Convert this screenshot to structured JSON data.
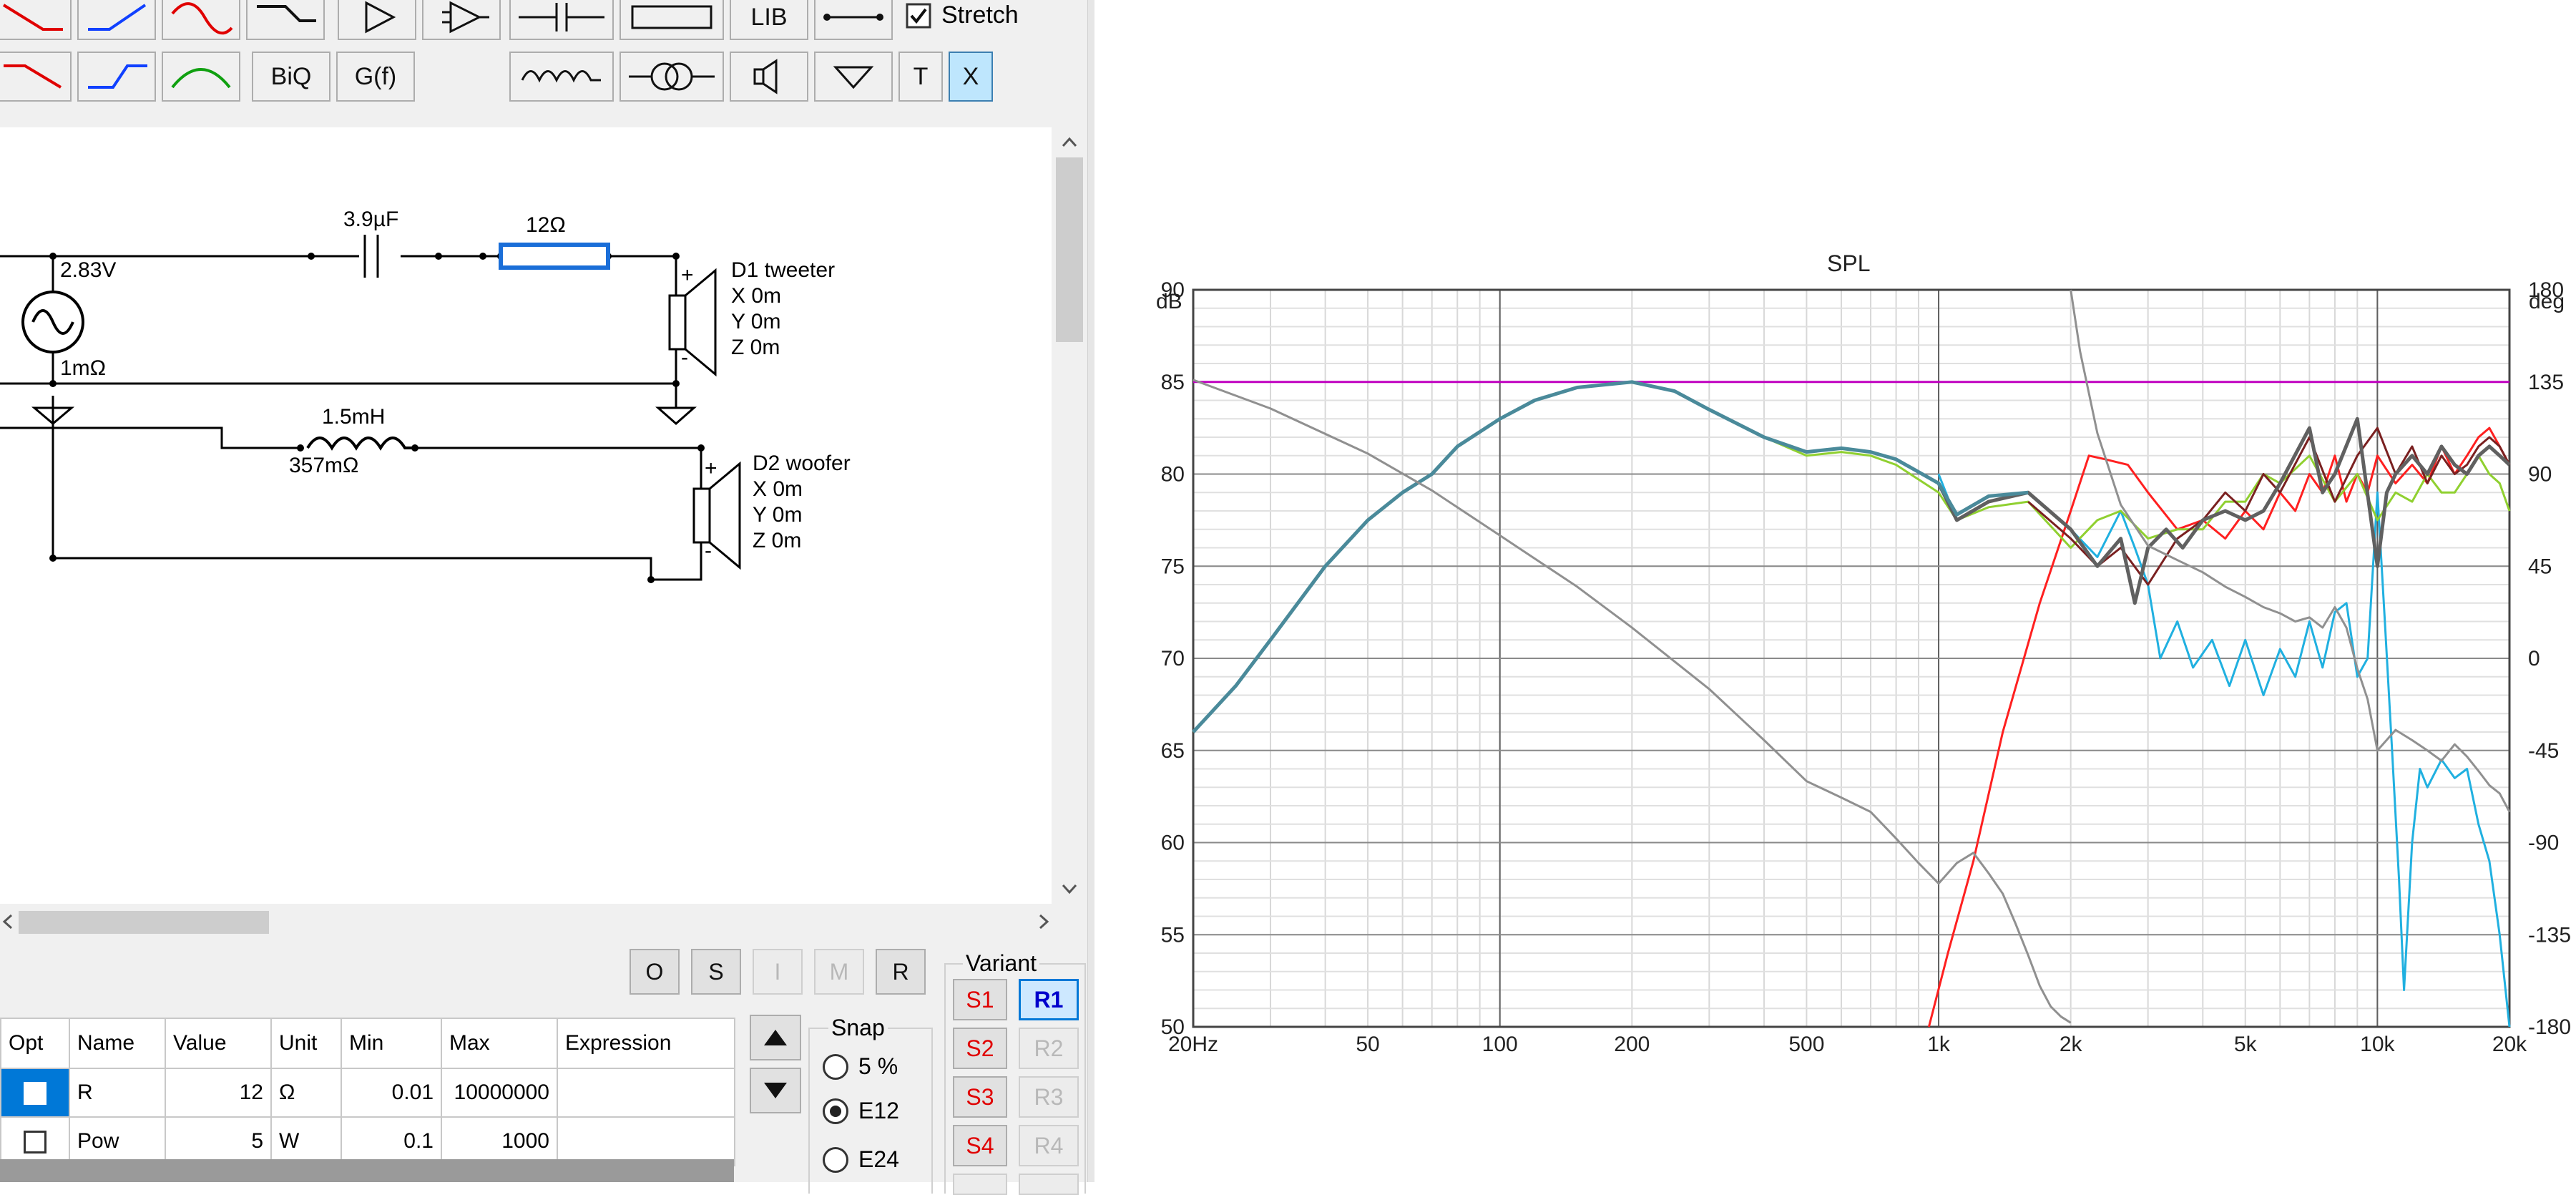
{
  "toolbar": {
    "lib_label": "LIB",
    "stretch_label": "Stretch",
    "stretch_checked": true,
    "biq_label": "BiQ",
    "gf_label": "G(f)",
    "t_label": "T",
    "x_label": "X"
  },
  "schematic": {
    "source_voltage": "2.83V",
    "source_resistance": "1mΩ",
    "capacitor_value": "3.9µF",
    "resistor_value": "12Ω",
    "inductor_value": "1.5mH",
    "inductor_resistance": "357mΩ",
    "driver1": {
      "name": "D1 tweeter",
      "x": "X 0m",
      "y": "Y 0m",
      "z": "Z 0m"
    },
    "driver2": {
      "name": "D2 woofer",
      "x": "X 0m",
      "y": "Y 0m",
      "z": "Z 0m"
    },
    "plus": "+",
    "minus": "-"
  },
  "opt_buttons": [
    "O",
    "S",
    "I",
    "M",
    "R"
  ],
  "table": {
    "headers": [
      "Opt",
      "Name",
      "Value",
      "Unit",
      "Min",
      "Max",
      "Expression"
    ],
    "rows": [
      {
        "name": "R",
        "value": "12",
        "unit": "Ω",
        "min": "0.01",
        "max": "10000000",
        "expression": ""
      },
      {
        "name": "Pow",
        "value": "5",
        "unit": "W",
        "min": "0.1",
        "max": "1000",
        "expression": ""
      }
    ]
  },
  "snap": {
    "label": "Snap",
    "options": [
      "5 %",
      "E12",
      "E24"
    ],
    "selected": "E12"
  },
  "variant": {
    "label": "Variant",
    "s_buttons": [
      "S1",
      "S2",
      "S3",
      "S4"
    ],
    "r_buttons": [
      "R1",
      "R2",
      "R3",
      "R4"
    ],
    "selected_r": "R1"
  },
  "chart_data": {
    "type": "line",
    "title": "SPL",
    "ylabel": "dB",
    "y2label": "deg",
    "xscale": "log",
    "xlim": [
      20,
      20000
    ],
    "ylim": [
      50,
      90
    ],
    "y2lim": [
      -180,
      180
    ],
    "xticks": [
      20,
      50,
      100,
      200,
      500,
      1000,
      2000,
      5000,
      10000,
      20000
    ],
    "xticklabels": [
      "20Hz",
      "50",
      "100",
      "200",
      "500",
      "1k",
      "2k",
      "5k",
      "10k",
      "20k"
    ],
    "yticks": [
      50,
      55,
      60,
      65,
      70,
      75,
      80,
      85,
      90
    ],
    "yticklabels": [
      "50",
      "55",
      "60",
      "65",
      "70",
      "75",
      "80",
      "85",
      "90"
    ],
    "y2ticks": [
      -180,
      -135,
      -90,
      -45,
      0,
      45,
      90,
      135,
      180
    ],
    "y2ticklabels": [
      "-180",
      "-135",
      "-90",
      "-45",
      "0",
      "45",
      "90",
      "135",
      "180"
    ],
    "grid": true,
    "series": [
      {
        "color": "#c000c0",
        "axis": "left",
        "x": [
          20,
          20000
        ],
        "y": [
          85,
          85
        ]
      },
      {
        "color": "#ff2020",
        "axis": "left",
        "x": [
          950,
          1050,
          1200,
          1400,
          1700,
          2000,
          2200,
          2400,
          2700,
          3000,
          3500,
          4000,
          4500,
          5000,
          5500,
          6000,
          6500,
          7000,
          7500,
          8000,
          8500,
          9000,
          9500,
          10000,
          11000,
          12000,
          13000,
          14000,
          15000,
          16000,
          17000,
          18000,
          19000,
          20000
        ],
        "y": [
          50,
          54,
          59,
          66,
          73,
          78,
          81,
          80.8,
          80.5,
          79,
          77,
          77.5,
          76.5,
          78,
          77,
          79,
          78,
          80,
          79,
          81,
          78.5,
          80,
          79,
          81,
          79.5,
          80.5,
          79.5,
          81.5,
          80,
          81,
          82,
          82.5,
          81.5,
          80.5
        ]
      },
      {
        "color": "#20b0e0",
        "axis": "left",
        "x": [
          1000,
          1100,
          1300,
          1600,
          2000,
          2300,
          2600,
          2800,
          3000,
          3200,
          3500,
          3800,
          4200,
          4600,
          5000,
          5500,
          6000,
          6500,
          7000,
          7500,
          8000,
          8500,
          9000,
          9500,
          10000,
          10400,
          10800,
          11200,
          11500,
          12000,
          12500,
          13000,
          14000,
          15000,
          16000,
          17000,
          18000,
          19000,
          20000
        ],
        "y": [
          80,
          77.5,
          78.5,
          79,
          77,
          75.5,
          78,
          76,
          74,
          70,
          72,
          69.5,
          71,
          68.5,
          71,
          68,
          70.5,
          69,
          72,
          69.5,
          72.5,
          73,
          69,
          70,
          79,
          72,
          65,
          58,
          52,
          60,
          64,
          63,
          64.5,
          63.5,
          64,
          61,
          59,
          55,
          50
        ]
      },
      {
        "color": "#90d030",
        "axis": "left",
        "x": [
          20,
          25,
          30,
          40,
          50,
          60,
          70,
          80,
          100,
          120,
          150,
          200,
          250,
          300,
          400,
          500,
          600,
          700,
          800,
          1000,
          1100,
          1300,
          1600,
          2000,
          2300,
          2600,
          3000,
          3500,
          4000,
          4500,
          5000,
          5500,
          6000,
          7000,
          8000,
          9000,
          10000,
          11000,
          12000,
          13000,
          14000,
          15000,
          16000,
          17000,
          18000,
          19000,
          20000
        ],
        "y": [
          66,
          68.5,
          71,
          75,
          77.5,
          79,
          80,
          81.5,
          83,
          84,
          84.7,
          85,
          84.5,
          83.5,
          82,
          81,
          81.2,
          81,
          80.5,
          79,
          77.5,
          78.2,
          78.5,
          76,
          77.5,
          78,
          76.5,
          77,
          77,
          78.5,
          78.5,
          80,
          79.5,
          81,
          78.5,
          80,
          77.5,
          79,
          78.5,
          80,
          79,
          79,
          80,
          81,
          80,
          79.5,
          78
        ]
      },
      {
        "color": "#7a2020",
        "axis": "left",
        "x": [
          1600,
          2000,
          2300,
          2600,
          3000,
          3500,
          4000,
          4500,
          5000,
          5500,
          6000,
          7000,
          8000,
          9000,
          10000,
          11000,
          12000,
          13000,
          14000,
          15000,
          16000,
          17000,
          18000,
          19000,
          20000
        ],
        "y": [
          78.5,
          76.5,
          75,
          76,
          74,
          76.5,
          77.5,
          79,
          78,
          80,
          79,
          82,
          78.5,
          81,
          82.5,
          80,
          81.5,
          79.5,
          81,
          80,
          80.5,
          81.5,
          82,
          81.5,
          80.5
        ]
      },
      {
        "color": "#606060",
        "axis": "left",
        "width": 5,
        "x": [
          1000,
          1100,
          1300,
          1600,
          2000,
          2300,
          2600,
          2800,
          3000,
          3300,
          3600,
          4000,
          4500,
          5000,
          5500,
          6000,
          7000,
          7500,
          8000,
          9000,
          10000,
          10500,
          11000,
          12000,
          13000,
          14000,
          15000,
          16000,
          17000,
          18000,
          19000,
          20000
        ],
        "y": [
          79.5,
          77.5,
          78.5,
          79,
          77,
          75,
          76.5,
          73,
          76,
          77,
          76,
          77.5,
          78,
          77.5,
          78,
          79.5,
          82.5,
          79,
          80,
          83,
          75,
          79,
          80,
          81,
          80,
          81.5,
          80.5,
          80,
          81,
          81.5,
          81,
          80.5
        ]
      },
      {
        "color": "#4a8a9a",
        "axis": "left",
        "width": 5,
        "x": [
          20,
          25,
          30,
          40,
          50,
          60,
          70,
          80,
          100,
          120,
          150,
          200,
          250,
          300,
          400,
          500,
          600,
          700,
          800,
          1000,
          1100,
          1300,
          1600
        ],
        "y": [
          66,
          68.5,
          71,
          75,
          77.5,
          79,
          80,
          81.5,
          83,
          84,
          84.7,
          85,
          84.5,
          83.5,
          82,
          81.2,
          81.4,
          81.2,
          80.8,
          79.5,
          77.8,
          78.8,
          79
        ]
      },
      {
        "color": "#909090",
        "axis": "right",
        "x": [
          20,
          30,
          50,
          70,
          100,
          150,
          200,
          300,
          400,
          500,
          600,
          700,
          800,
          900,
          1000,
          1100,
          1200,
          1300,
          1400,
          1500,
          1600,
          1700,
          1800,
          1900,
          2000
        ],
        "y": [
          136,
          122,
          100,
          82,
          60,
          35,
          15,
          -15,
          -40,
          -60,
          -68,
          -75,
          -88,
          -100,
          -110,
          -100,
          -95,
          -105,
          -115,
          -130,
          -145,
          -160,
          -170,
          -175,
          -178
        ]
      },
      {
        "color": "#909090",
        "axis": "right",
        "x": [
          2000,
          2100,
          2300,
          2600,
          3000,
          3500,
          4000,
          4500,
          5000,
          5500,
          6000,
          6500,
          7000,
          7500,
          8000,
          8500,
          9000,
          9500,
          10000,
          11000,
          12000,
          13000,
          14000,
          15000,
          16000,
          17000,
          18000,
          19000,
          20000
        ],
        "y": [
          180,
          150,
          110,
          75,
          55,
          48,
          42,
          35,
          30,
          25,
          22,
          18,
          20,
          15,
          25,
          15,
          -5,
          -20,
          -45,
          -35,
          -40,
          -45,
          -50,
          -42,
          -48,
          -55,
          -62,
          -66,
          -75
        ]
      }
    ]
  }
}
